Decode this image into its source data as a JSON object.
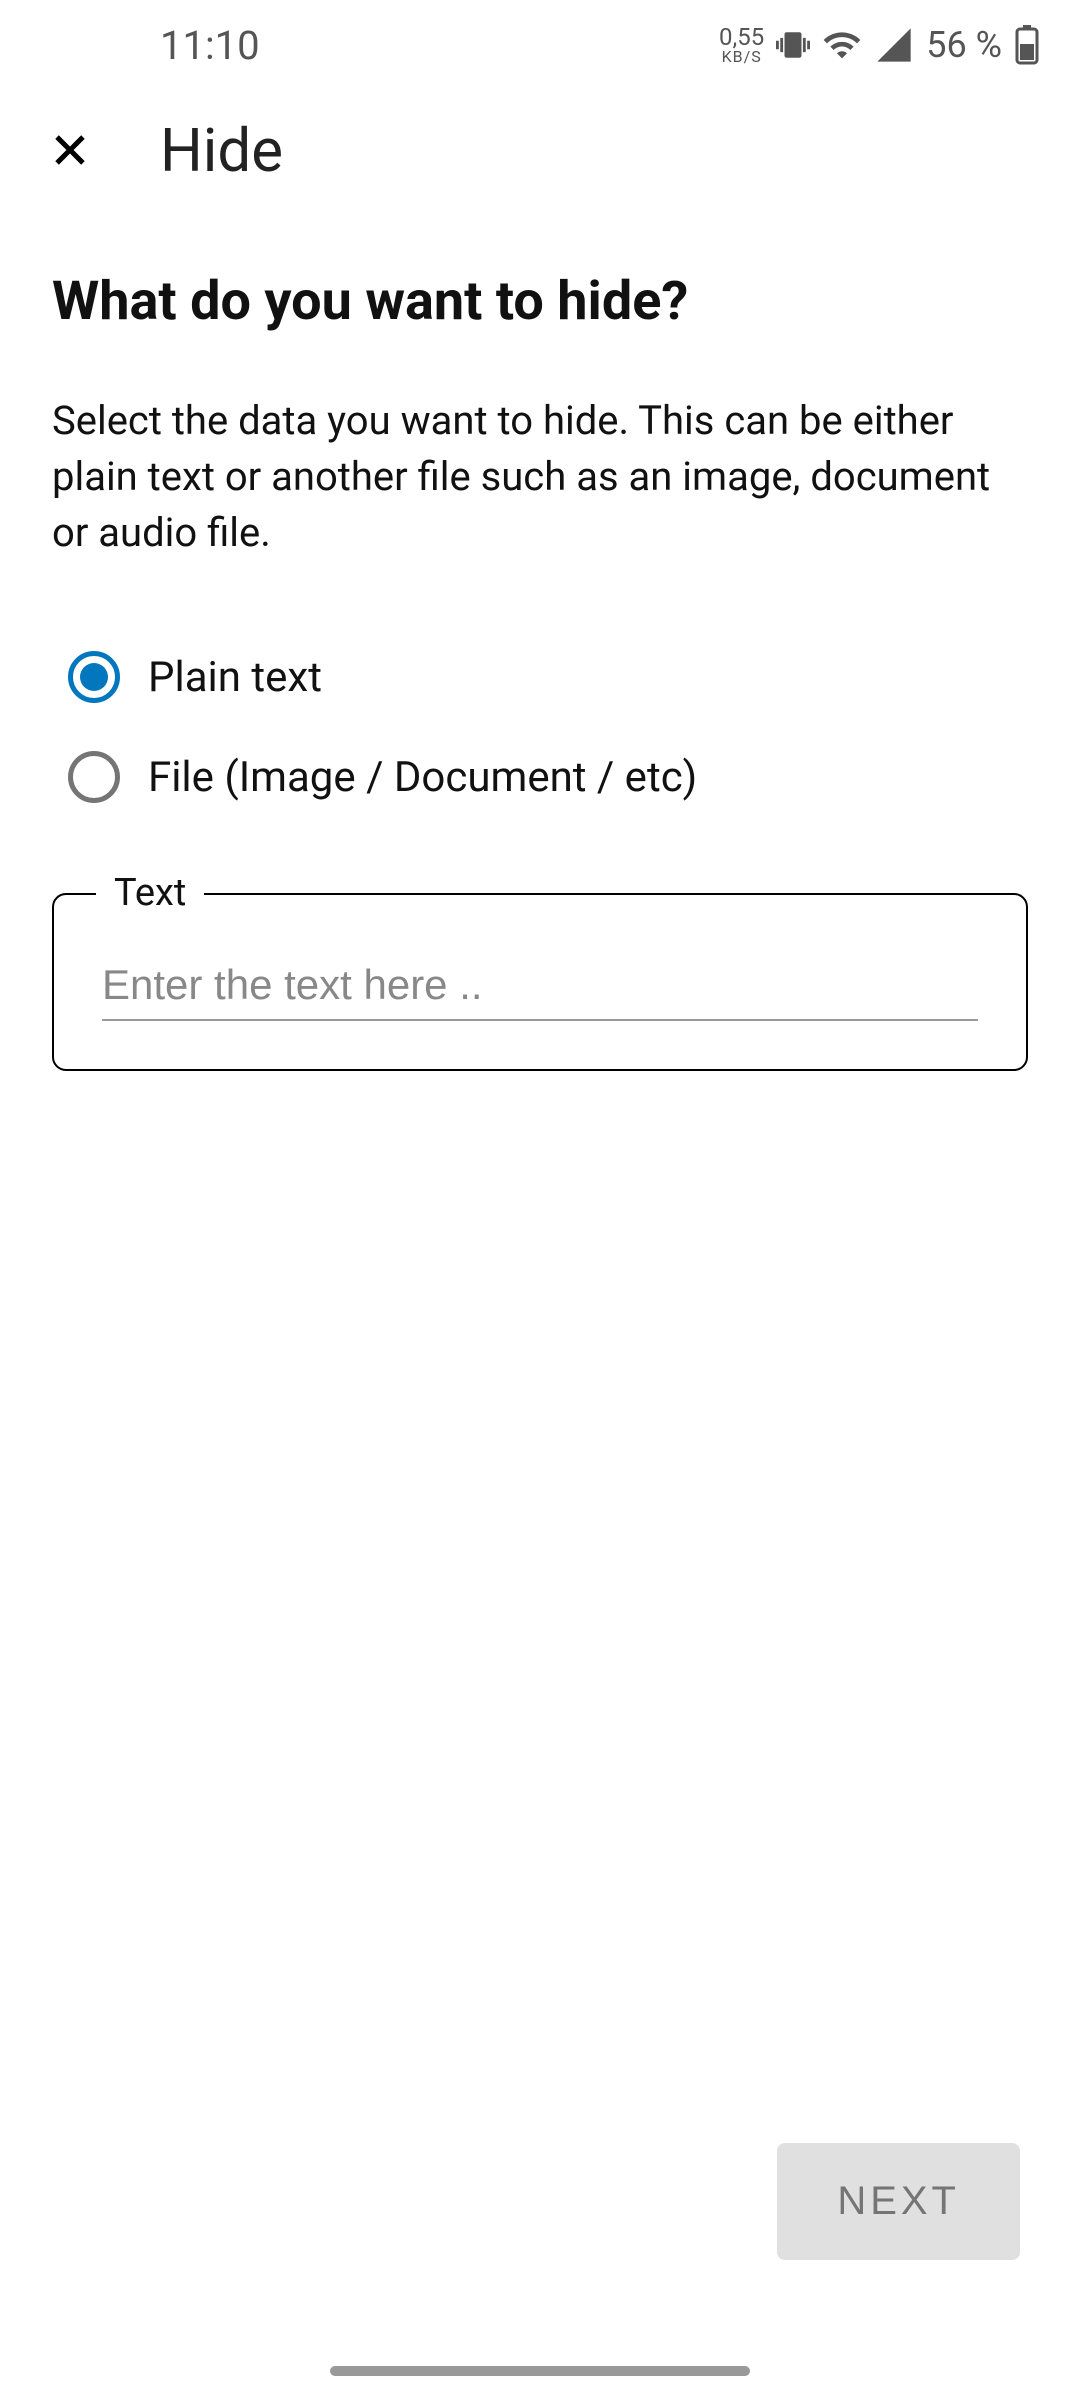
{
  "status": {
    "time": "11:10",
    "kbps_num": "0,55",
    "kbps_label": "KB/S",
    "battery_percent": "56 %"
  },
  "appbar": {
    "title": "Hide"
  },
  "main": {
    "heading": "What do you want to hide?",
    "description": "Select the data you want to hide. This can be either plain text or another file such as an image, document or audio file.",
    "radio_options": [
      {
        "label": "Plain text",
        "selected": true
      },
      {
        "label": "File (Image / Document / etc)",
        "selected": false
      }
    ],
    "text_field": {
      "legend": "Text",
      "placeholder": "Enter the text here ..",
      "value": ""
    }
  },
  "footer": {
    "next_label": "NEXT"
  }
}
